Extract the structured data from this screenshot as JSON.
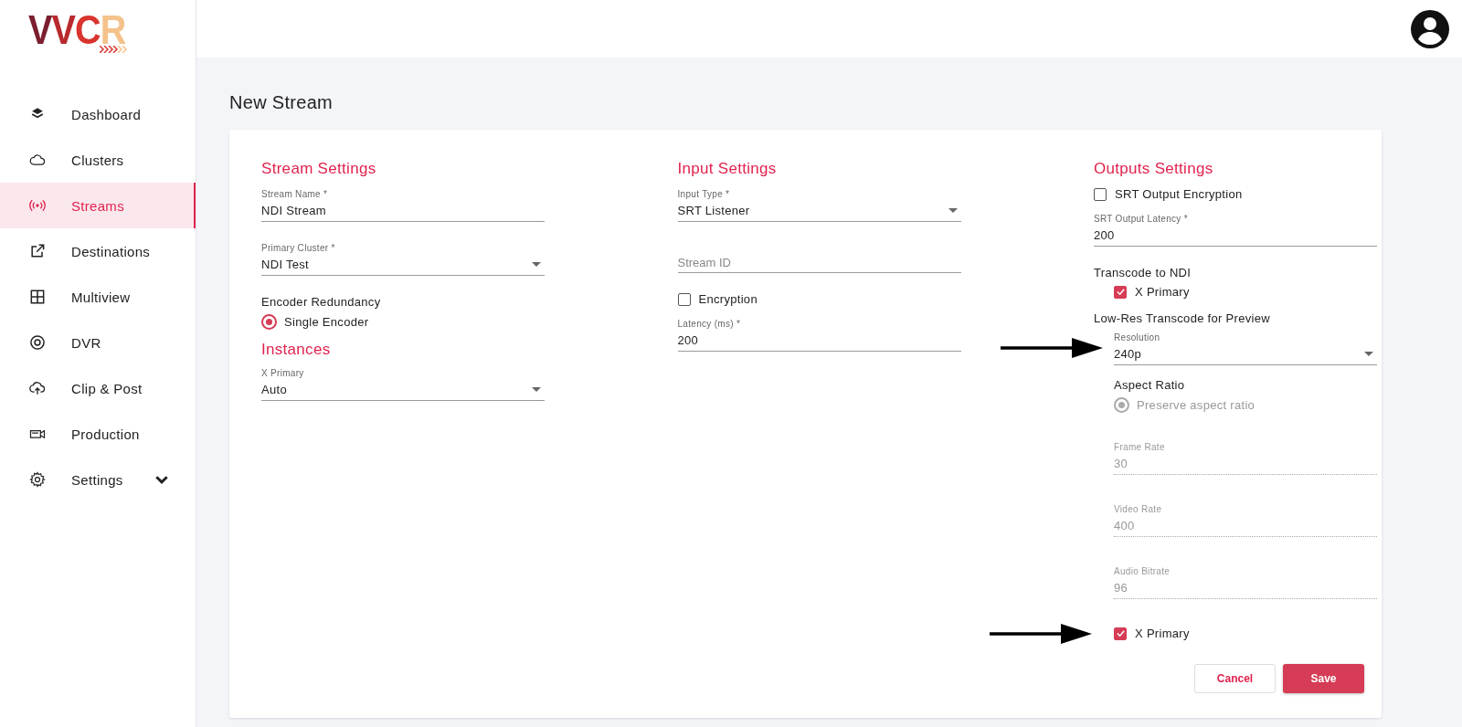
{
  "logo": {
    "letters": [
      {
        "text": "V",
        "color": "#7b1e2e"
      },
      {
        "text": "V",
        "color": "#b82a2e"
      },
      {
        "text": "C",
        "color": "#d9342f"
      },
      {
        "text": "R",
        "color": "#f4c28a"
      }
    ]
  },
  "sidebar": {
    "items": [
      {
        "label": "Dashboard",
        "selected": false
      },
      {
        "label": "Clusters",
        "selected": false
      },
      {
        "label": "Streams",
        "selected": true
      },
      {
        "label": "Destinations",
        "selected": false
      },
      {
        "label": "Multiview",
        "selected": false
      },
      {
        "label": "DVR",
        "selected": false
      },
      {
        "label": "Clip & Post",
        "selected": false
      },
      {
        "label": "Production",
        "selected": false
      },
      {
        "label": "Settings",
        "selected": false,
        "expanded": false
      }
    ]
  },
  "page_title": "New Stream",
  "form": {
    "columns": [
      {
        "items": [
          {
            "kind": "heading",
            "text": "Stream Settings"
          },
          {
            "kind": "text_field",
            "label": "Stream Name *",
            "value": "NDI Stream"
          },
          {
            "kind": "select",
            "label": "Primary Cluster *",
            "value": "NDI Test"
          },
          {
            "kind": "label",
            "text": "Encoder Redundancy"
          },
          {
            "kind": "radio",
            "label": "Single Encoder",
            "selected": true,
            "disabled": false
          },
          {
            "kind": "heading",
            "text": "Instances"
          },
          {
            "kind": "select",
            "label": "X Primary",
            "value": "Auto"
          }
        ]
      },
      {
        "items": [
          {
            "kind": "heading",
            "text": "Input Settings"
          },
          {
            "kind": "select",
            "label": "Input Type *",
            "value": "SRT Listener"
          },
          {
            "kind": "text_field",
            "placeholder": "Stream ID"
          },
          {
            "kind": "checkbox",
            "label": "Encryption",
            "checked": false
          },
          {
            "kind": "text_field",
            "label": "Latency (ms) *",
            "value": "200"
          }
        ]
      },
      {
        "items": [
          {
            "kind": "heading",
            "text": "Outputs Settings"
          },
          {
            "kind": "checkbox",
            "label": "SRT Output Encryption",
            "checked": false
          },
          {
            "kind": "text_field",
            "label": "SRT Output Latency *",
            "value": "200"
          },
          {
            "kind": "group",
            "text": "Transcode to NDI",
            "children": [
              {
                "kind": "checkbox",
                "label": "X Primary",
                "checked": true
              }
            ]
          },
          {
            "kind": "group",
            "text": "Low-Res Transcode for Preview",
            "children": [
              {
                "kind": "select",
                "label": "Resolution",
                "value": "240p",
                "arrow": true
              },
              {
                "kind": "label",
                "text": "Aspect Ratio"
              },
              {
                "kind": "radio",
                "label": "Preserve aspect ratio",
                "selected": true,
                "disabled": true
              },
              {
                "kind": "text_field",
                "label": "Frame Rate",
                "value": "30",
                "disabled": true
              },
              {
                "kind": "text_field",
                "label": "Video Rate",
                "value": "400",
                "disabled": true
              },
              {
                "kind": "text_field",
                "label": "Audio Bitrate",
                "value": "96",
                "disabled": true
              },
              {
                "kind": "checkbox",
                "label": "X Primary",
                "checked": true,
                "arrow": true
              }
            ]
          }
        ]
      }
    ],
    "buttons": [
      {
        "label": "Cancel",
        "kind": "secondary"
      },
      {
        "label": "Save",
        "kind": "primary"
      }
    ]
  }
}
